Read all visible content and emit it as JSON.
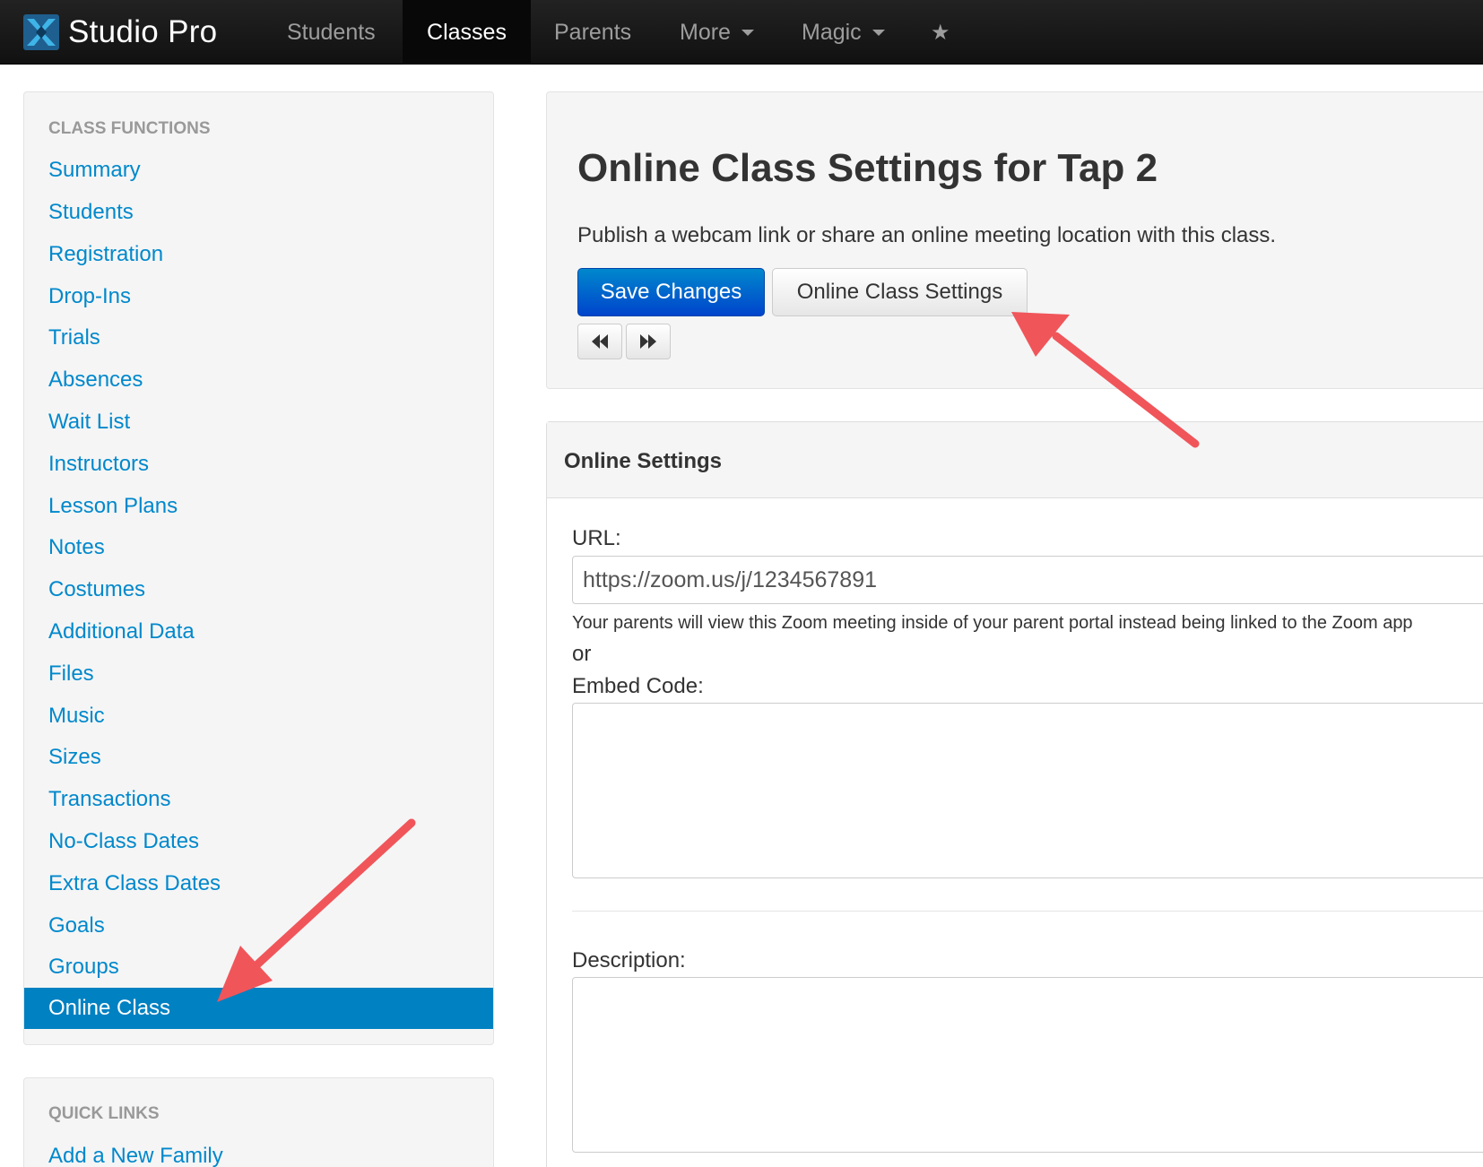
{
  "navbar": {
    "brand": "Studio Pro",
    "items": [
      {
        "label": "Students"
      },
      {
        "label": "Classes"
      },
      {
        "label": "Parents"
      },
      {
        "label": "More"
      },
      {
        "label": "Magic"
      }
    ],
    "icons": {
      "brand": "studio-pro-logo-icon",
      "favorite": "star-icon",
      "dropdown": "caret-down-icon"
    }
  },
  "sidebar": {
    "class_functions_header": "CLASS FUNCTIONS",
    "items": [
      {
        "label": "Summary"
      },
      {
        "label": "Students"
      },
      {
        "label": "Registration"
      },
      {
        "label": "Drop-Ins"
      },
      {
        "label": "Trials"
      },
      {
        "label": "Absences"
      },
      {
        "label": "Wait List"
      },
      {
        "label": "Instructors"
      },
      {
        "label": "Lesson Plans"
      },
      {
        "label": "Notes"
      },
      {
        "label": "Costumes"
      },
      {
        "label": "Additional Data"
      },
      {
        "label": "Files"
      },
      {
        "label": "Music"
      },
      {
        "label": "Sizes"
      },
      {
        "label": "Transactions"
      },
      {
        "label": "No-Class Dates"
      },
      {
        "label": "Extra Class Dates"
      },
      {
        "label": "Goals"
      },
      {
        "label": "Groups"
      },
      {
        "label": "Online Class"
      }
    ],
    "active_item": "Online Class",
    "quick_links_header": "QUICK LINKS",
    "quick_links": [
      {
        "label": "Add a New Family"
      }
    ]
  },
  "header": {
    "title": "Online Class Settings for Tap 2",
    "lead": "Publish a webcam link or share an online meeting location with this class.",
    "save_button": "Save Changes",
    "settings_button": "Online Class Settings",
    "prev_icon": "backward-icon",
    "next_icon": "forward-icon"
  },
  "online_settings": {
    "heading": "Online Settings",
    "url_label": "URL:",
    "url_value": "https://zoom.us/j/1234567891",
    "url_help": "Your parents will view this Zoom meeting inside of your parent portal instead being linked to the Zoom app",
    "or_text": "or",
    "embed_label": "Embed Code:",
    "embed_value": "",
    "description_label": "Description:",
    "description_value": ""
  },
  "colors": {
    "navbar": "#1b1b1b",
    "link": "#0088cc",
    "active_item": "#0081c2",
    "primary_button": "#0055cc",
    "annotation_arrow": "#f0555a"
  }
}
